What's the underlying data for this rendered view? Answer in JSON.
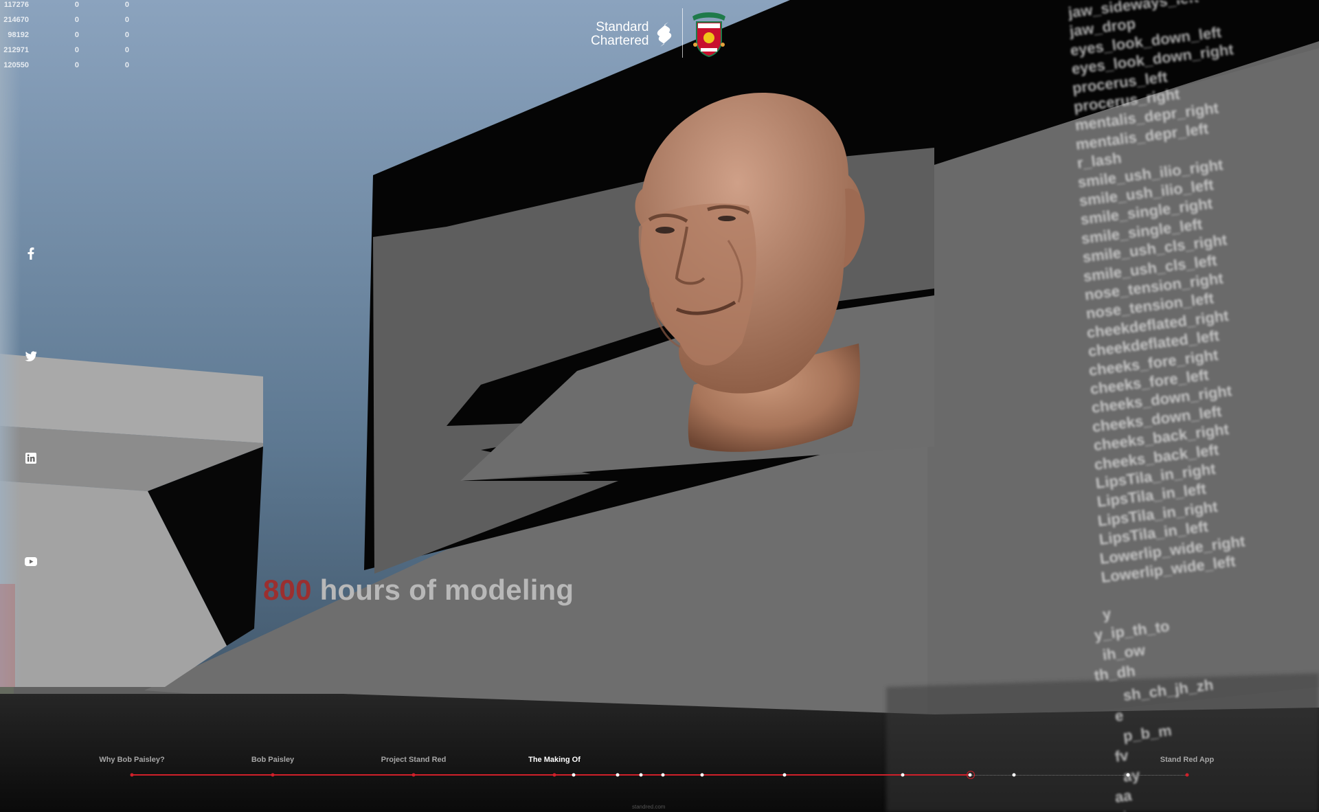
{
  "stats": [
    [
      "117276",
      "0",
      "0"
    ],
    [
      "214670",
      "0",
      "0"
    ],
    [
      "98192",
      "0",
      "0"
    ],
    [
      "212971",
      "0",
      "0"
    ],
    [
      "120550",
      "0",
      "0"
    ]
  ],
  "header": {
    "sponsor_line1": "Standard",
    "sponsor_line2": "Chartered",
    "sponsor_mark_icon": "standard-chartered-mark-icon",
    "club_crest_icon": "liverpool-fc-crest-icon"
  },
  "social": [
    {
      "name": "facebook-icon"
    },
    {
      "name": "twitter-icon"
    },
    {
      "name": "linkedin-icon"
    },
    {
      "name": "youtube-icon"
    }
  ],
  "headline": {
    "number": "800",
    "text": "hours of modeling"
  },
  "morph_targets": [
    "jaw_sideways_left",
    "jaw_drop",
    "eyes_look_down_left",
    "eyes_look_down_right",
    "procerus_left",
    "procerus_right",
    "mentalis_depr_right",
    "mentalis_depr_left",
    "r_lash",
    "smile_ush_ilio_right",
    "smile_ush_ilio_left",
    "smile_single_right",
    "smile_single_left",
    "smile_ush_cls_right",
    "smile_ush_cls_left",
    "nose_tension_right",
    "nose_tension_left",
    "cheekdeflated_right",
    "cheekdeflated_left",
    "cheeks_fore_right",
    "cheeks_fore_left",
    "cheeks_down_right",
    "cheeks_down_left",
    "cheeks_back_right",
    "cheeks_back_left",
    "LipsTila_in_right",
    "LipsTila_in_left",
    "LipsTila_in_right",
    "LipsTila_in_left",
    "Lowerlip_wide_right",
    "Lowerlip_wide_left",
    "y",
    "y_ip_th_to",
    "ih_ow",
    "th_dh",
    "sh_ch_jh_zh",
    "e",
    "p_b_m",
    "fv",
    "ay",
    "aa",
    "l_r"
  ],
  "nav": {
    "sections": [
      {
        "label": "Why Bob Paisley?",
        "active": false
      },
      {
        "label": "Bob Paisley",
        "active": false
      },
      {
        "label": "Project Stand Red",
        "active": false
      },
      {
        "label": "The Making Of",
        "active": true
      },
      {
        "label": "Stand Red App",
        "active": false
      }
    ],
    "progress": 0.795
  },
  "footer": {
    "text": "standred.com"
  },
  "colors": {
    "accent_red": "#d0202a",
    "headline_red": "#9b2f2f",
    "headline_gray": "#b8b8b8",
    "sky_top": "#8aa2bd",
    "sky_bottom": "#3e5366"
  }
}
